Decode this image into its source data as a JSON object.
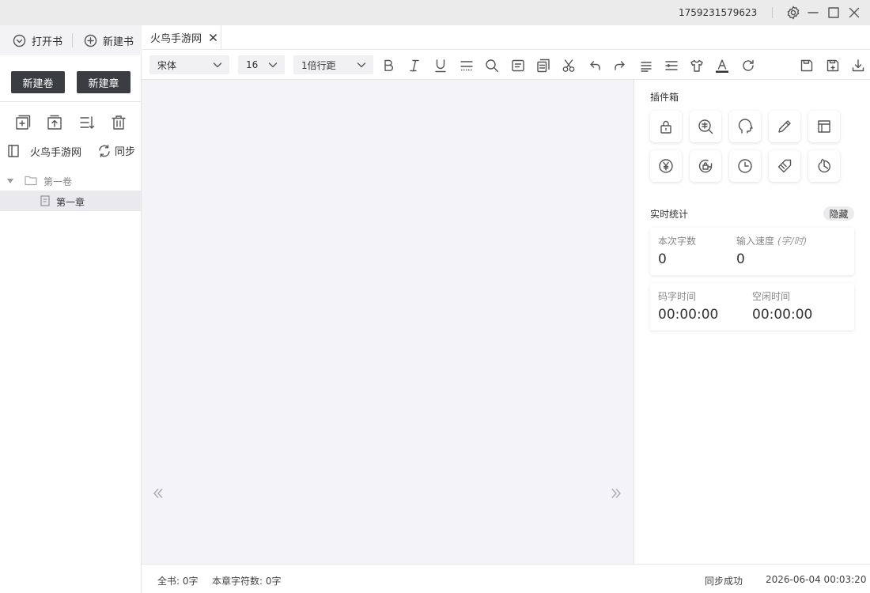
{
  "titlebar": {
    "phone": "1759231579623",
    "icons": [
      "gear-icon",
      "minimize-icon",
      "maximize-icon",
      "close-icon"
    ]
  },
  "sidebar": {
    "open_book": "打开书",
    "new_book": "新建书",
    "new_volume": "新建卷",
    "new_chapter": "新建章",
    "tools": [
      "add-chapter-icon",
      "upload-icon",
      "sort-icon",
      "trash-icon"
    ],
    "book_name": "火鸟手游网",
    "sync": "同步",
    "tree": {
      "volume": "第一卷",
      "chapter": "第一章"
    }
  },
  "tabs": [
    {
      "label": "火鸟手游网",
      "active": true
    }
  ],
  "toolbar": {
    "font": "宋体",
    "size": "16",
    "line_spacing": "1倍行距",
    "icons": [
      "bold-icon",
      "italic-icon",
      "underline-icon",
      "divider-line-icon",
      "search-icon",
      "note-icon",
      "copy-icon",
      "scissors-icon",
      "undo-icon",
      "redo-icon",
      "paragraph-icon",
      "indent-icon",
      "shirt-icon",
      "font-color-icon",
      "refresh-icon",
      "save-icon",
      "save-as-icon",
      "download-icon"
    ]
  },
  "plugins": {
    "title": "插件箱",
    "icons": [
      "lock-icon",
      "dictionary-search-icon",
      "head-icon",
      "pencil-icon",
      "layout-icon",
      "yen-icon",
      "lock-refresh-icon",
      "clock-icon",
      "tag-icon",
      "pie-timer-icon"
    ]
  },
  "stats": {
    "title": "实时统计",
    "hide": "隐藏",
    "session_words_label": "本次字数",
    "session_words": "0",
    "speed_label": "输入速度",
    "speed_unit": "(字/时)",
    "speed": "0",
    "typing_time_label": "码字时间",
    "typing_time": "00:00:00",
    "idle_time_label": "空闲时间",
    "idle_time": "00:00:00"
  },
  "statusbar": {
    "total": "全书: 0字",
    "chapter_chars": "本章字符数: 0字",
    "sync_status": "同步成功",
    "datetime": "2026-06-04 00:03:20"
  },
  "colors": {
    "dark_button": "#3a3d42",
    "editor_bg": "#f3f3f8",
    "titlebar_bg": "#ebebeb"
  }
}
